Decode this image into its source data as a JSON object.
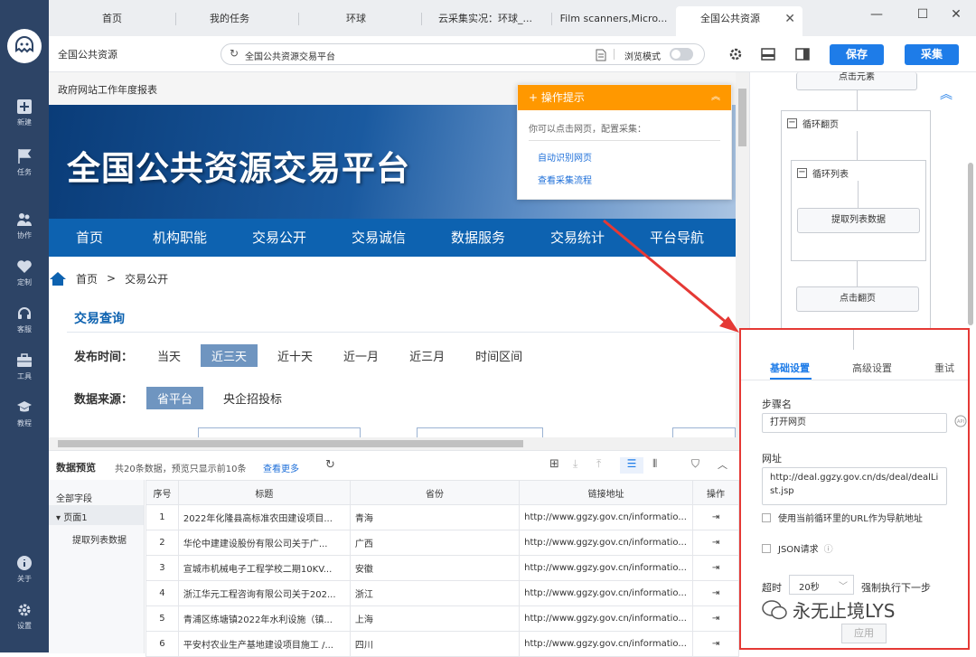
{
  "tabs": [
    "首页",
    "我的任务",
    "环球",
    "云采集实况：环球_...",
    "Film scanners,Micro...",
    "全国公共资源"
  ],
  "toolbar": {
    "page_name": "全国公共资源",
    "url": "全国公共资源交易平台",
    "browse_mode": "浏览模式",
    "save": "保存",
    "collect": "采集"
  },
  "sidebar": [
    {
      "label": "新建",
      "icon": "plus-square-icon"
    },
    {
      "label": "任务",
      "icon": "flag-icon"
    },
    {
      "label": "协作",
      "icon": "people-icon"
    },
    {
      "label": "定制",
      "icon": "heart-icon"
    },
    {
      "label": "客服",
      "icon": "headset-icon"
    },
    {
      "label": "工具",
      "icon": "toolbox-icon"
    },
    {
      "label": "教程",
      "icon": "graduation-cap-icon"
    },
    {
      "label": "关于",
      "icon": "info-icon"
    },
    {
      "label": "设置",
      "icon": "gear-icon"
    }
  ],
  "web": {
    "header_link": "政府网站工作年度报表",
    "banner_title": "全国公共资源交易平台",
    "nav": [
      "首页",
      "机构职能",
      "交易公开",
      "交易诚信",
      "数据服务",
      "交易统计",
      "平台导航"
    ],
    "crumb_home": "首页",
    "crumb_sep": ">",
    "crumb_current": "交易公开",
    "query_title": "交易查询",
    "time_label": "发布时间：",
    "time_options": [
      "当天",
      "近三天",
      "近十天",
      "近一月",
      "近三月",
      "时间区间"
    ],
    "time_selected": 1,
    "source_label": "数据来源：",
    "source_options": [
      "省平台",
      "央企招投标"
    ],
    "source_selected": 0
  },
  "tip": {
    "title": "操作提示",
    "desc": "你可以点击网页，配置采集：",
    "links": [
      "自动识别网页",
      "查看采集流程"
    ]
  },
  "flow": {
    "click_element": "点击元素",
    "loop_page": "循环翻页",
    "loop_list": "循环列表",
    "extract": "提取列表数据",
    "click_next": "点击翻页"
  },
  "panel": {
    "tabs": [
      "基础设置",
      "高级设置",
      "重试"
    ],
    "step_label": "步骤名",
    "step_value": "打开网页",
    "url_label": "网址",
    "url_value": "http://deal.ggzy.gov.cn/ds/deal/dealList.jsp",
    "use_loop_url": "使用当前循环里的URL作为导航地址",
    "json_req": "JSON请求",
    "timeout_label": "超时",
    "timeout_value": "20秒",
    "force_next": "强制执行下一步",
    "apply": "应用"
  },
  "preview": {
    "title": "数据预览",
    "summary": "共20条数据，预览只显示前10条",
    "more": "查看更多",
    "all_fields": "全部字段",
    "page1": "页面1",
    "extract_list": "提取列表数据",
    "columns": [
      "序号",
      "标题",
      "省份",
      "链接地址",
      "操作"
    ],
    "rows": [
      {
        "no": "1",
        "title": "2022年化隆县高标准农田建设项目...",
        "prov": "青海",
        "link": "http://www.ggzy.gov.cn/informatio..."
      },
      {
        "no": "2",
        "title": "华伦中建建设股份有限公司关于广...",
        "prov": "广西",
        "link": "http://www.ggzy.gov.cn/informatio..."
      },
      {
        "no": "3",
        "title": "宣城市机械电子工程学校二期10KV...",
        "prov": "安徽",
        "link": "http://www.ggzy.gov.cn/informatio..."
      },
      {
        "no": "4",
        "title": "浙江华元工程咨询有限公司关于202...",
        "prov": "浙江",
        "link": "http://www.ggzy.gov.cn/informatio..."
      },
      {
        "no": "5",
        "title": "青浦区练塘镇2022年水利设施（镇...",
        "prov": "上海",
        "link": "http://www.ggzy.gov.cn/informatio..."
      },
      {
        "no": "6",
        "title": "平安村农业生产基地建设项目施工 /...",
        "prov": "四川",
        "link": "http://www.ggzy.gov.cn/informatio..."
      }
    ]
  },
  "watermark": "永无止境LYS"
}
